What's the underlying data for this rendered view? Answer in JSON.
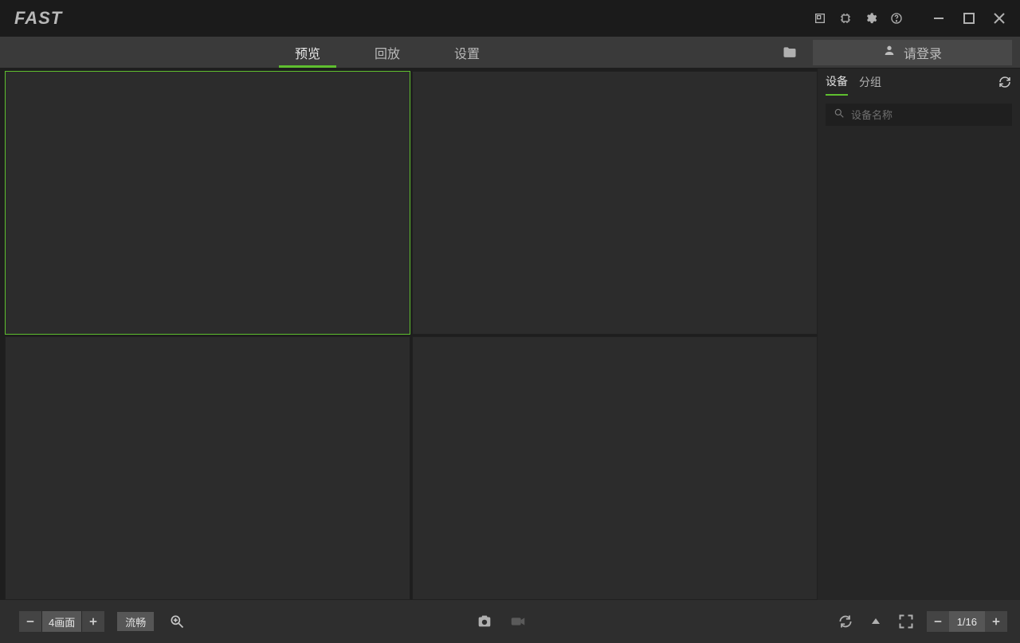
{
  "app": {
    "name": "FAST"
  },
  "titlebar_icons": {
    "screenshot": "screenshot-icon",
    "cpu": "cpu-icon",
    "settings": "gear-icon",
    "help": "help-icon"
  },
  "tabs": {
    "preview": "预览",
    "playback": "回放",
    "settings": "设置"
  },
  "login": {
    "label": "请登录"
  },
  "sidebar": {
    "tab_device": "设备",
    "tab_group": "分组",
    "search_placeholder": "设备名称"
  },
  "bottom": {
    "layout_label": "4画面",
    "quality_label": "流畅",
    "page_label": "1/16"
  }
}
